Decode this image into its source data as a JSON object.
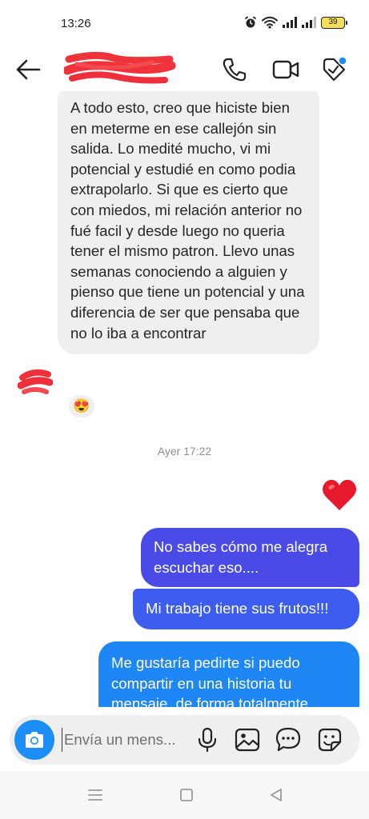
{
  "status_bar": {
    "time": "13:26",
    "battery": "39",
    "icons": [
      "alarm-icon",
      "wifi-icon",
      "signal-icon",
      "signal-icon",
      "battery-icon"
    ]
  },
  "header": {
    "icons": [
      "back-arrow-icon",
      "phone-icon",
      "video-camera-icon",
      "tag-icon"
    ],
    "notification_dot_color": "#1d8ef5"
  },
  "messages": {
    "incoming": {
      "text": "A todo esto, creo que hiciste bien en meterme en ese callejón sin salida. Lo medité mucho, vi mi potencial y estudié en como podia extrapolarlo. Si que es cierto que con miedos, mi relación anterior no fué facil y desde luego no queria tener el mismo patron. Llevo unas semanas conociendo a alguien y pienso que tiene un potencial y una diferencia de ser que pensaba que no lo iba a encontrar",
      "reaction": "😍"
    },
    "timestamp": "Ayer 17:22",
    "heart_reaction": "❤️",
    "outgoing": [
      {
        "text": "No sabes cómo me alegra escuchar eso...."
      },
      {
        "text": "Mi trabajo tiene sus frutos!!!"
      },
      {
        "text": "Me gustaría pedirte si puedo compartir en una historia tu mensaje, de forma totalmente"
      }
    ]
  },
  "composer": {
    "placeholder": "Envía un mens...",
    "icons": [
      "camera-icon",
      "microphone-icon",
      "gallery-icon",
      "chat-bubble-icon",
      "sticker-icon"
    ]
  },
  "navbar": {
    "icons": [
      "menu-icon",
      "home-icon",
      "back-triangle-icon"
    ]
  },
  "colors": {
    "incoming_bubble": "#efefef",
    "outgoing_1": "#4a4be6",
    "outgoing_2": "#3d5df0",
    "outgoing_3": "#1f86f5",
    "accent": "#1d8ef5",
    "redaction": "#f0333a"
  }
}
